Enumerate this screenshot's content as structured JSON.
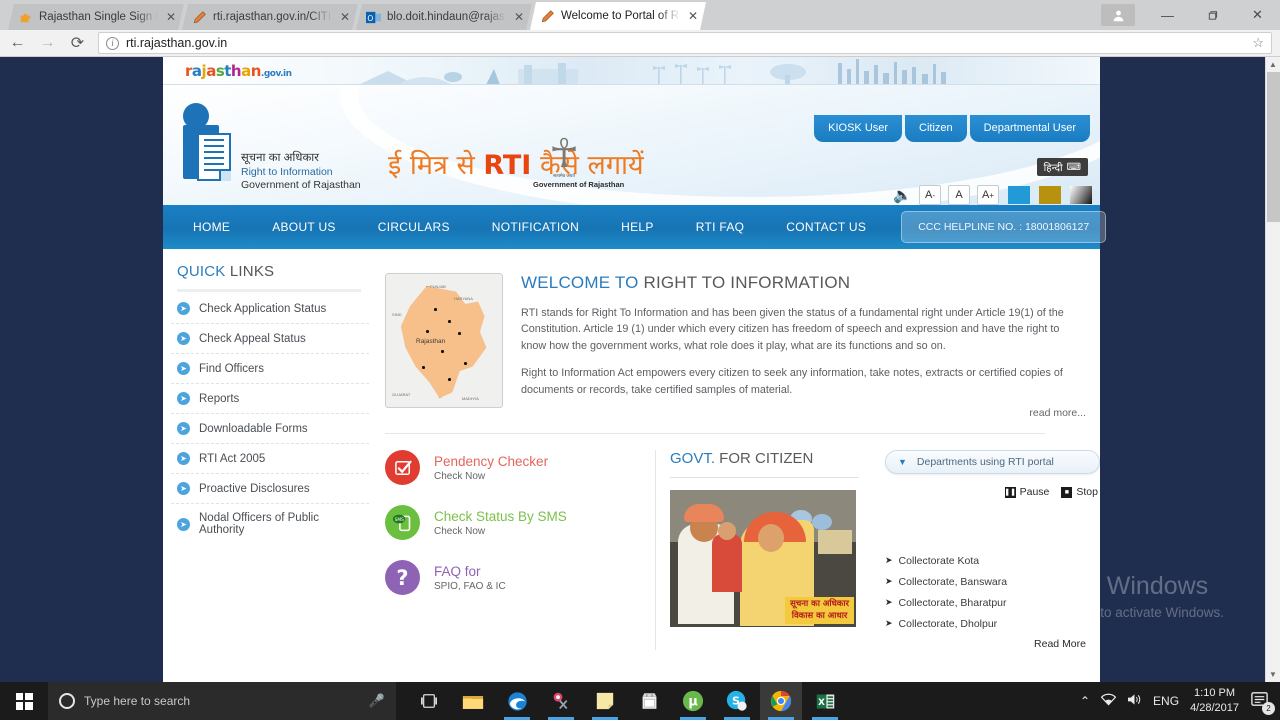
{
  "browser": {
    "tabs": [
      {
        "title": "Rajasthan Single Sign On",
        "favicon": "puzzle-icon",
        "active": false
      },
      {
        "title": "rti.rajasthan.gov.in/CITIZ",
        "favicon": "pencil-icon",
        "active": false
      },
      {
        "title": "blo.doit.hindaun@rajasth",
        "favicon": "outlook-icon",
        "active": false
      },
      {
        "title": "Welcome to Portal of Rig",
        "favicon": "pencil-icon",
        "active": true
      }
    ],
    "close_label": "✕",
    "window_controls": {
      "minimize": "—",
      "maximize": "❐",
      "close": "✕"
    },
    "toolbar": {
      "back": "←",
      "forward": "→",
      "reload": "⟳",
      "star": "☆"
    },
    "address": {
      "url": "rti.rajasthan.gov.in",
      "security": "info-icon"
    }
  },
  "site": {
    "brand": {
      "logo_parts": [
        "r",
        "a",
        "j",
        "a",
        "s",
        "t",
        "h",
        "a",
        "n"
      ],
      "logo_suffix": ".gov.in"
    },
    "masthead": {
      "rti_hindi": "सूचना का अधिकार",
      "rti_en1": "Right to Information",
      "rti_en2": "Government of Rajasthan",
      "banner_pre": "ई मित्र से ",
      "banner_rti": "RTI",
      "banner_post": " कैसे लगायें",
      "emblem_hindi": "सत्यमेव जयते",
      "emblem_caption": "Government of Rajasthan",
      "user_tabs": [
        "KIOSK User",
        "Citizen",
        "Departmental User"
      ],
      "hindi_button": "हिन्दी",
      "speaker_icon": "speaker-icon",
      "font_smaller": "A",
      "font_smaller_sup": "-",
      "font_normal": "A",
      "font_larger": "A",
      "font_larger_sup": "+",
      "theme_swatches": [
        "#229ad6",
        "#b8920f",
        "#000000"
      ]
    },
    "nav": {
      "items": [
        "HOME",
        "ABOUT US",
        "CIRCULARS",
        "NOTIFICATION",
        "HELP",
        "RTI FAQ",
        "CONTACT US"
      ],
      "helpline": "CCC HELPLINE NO. : 18001806127"
    },
    "sidebar": {
      "title_accent": "QUICK",
      "title_rest": " LINKS",
      "items": [
        "Check Application Status",
        "Check Appeal Status",
        "Find Officers",
        "Reports",
        "Downloadable Forms",
        "RTI Act 2005",
        "Proactive Disclosures",
        "Nodal Officers of Public Authority"
      ]
    },
    "welcome": {
      "title_accent": "WELCOME TO",
      "title_rest": " RIGHT TO INFORMATION",
      "map_label": "Rajasthan",
      "paragraph1": "RTI stands for Right To Information and has been given the status of a fundamental right under Article 19(1) of the Constitution. Article 19 (1) under which every citizen has freedom of speech and expression and have the right to know how the government works, what role does it play, what are its functions and so on.",
      "paragraph2": "Right to Information Act empowers every citizen to seek any information, take notes, extracts or certified copies of documents or records, take certified samples of material.",
      "read_more": "read more..."
    },
    "services": [
      {
        "title": "Pendency Checker",
        "subtitle": "Check Now",
        "icon": "checkbox-tick-icon",
        "color": "red"
      },
      {
        "title": "Check Status By SMS",
        "subtitle": "Check Now",
        "icon": "sms-phone-icon",
        "color": "green"
      },
      {
        "title": "FAQ for",
        "subtitle": "SPIO, FAO & IC",
        "icon": "question-mark-icon",
        "color": "purple"
      }
    ],
    "citizen": {
      "title_accent": "GOVT.",
      "title_rest": " FOR CITIZEN",
      "poster_caption_line1": "सूचना का अधिकार",
      "poster_caption_line2": "विकास का आधार"
    },
    "departments": {
      "header": "Departments using RTI portal",
      "pause": "Pause",
      "stop": "Stop",
      "items": [
        "Collectorate Kota",
        "Collectorate, Banswara",
        "Collectorate, Bharatpur",
        "Collectorate, Dholpur"
      ],
      "read_more": "Read More"
    }
  },
  "watermark": {
    "line1": "Activate Windows",
    "line2": "Go to Settings to activate Windows."
  },
  "taskbar": {
    "search_placeholder": "Type here to search",
    "icons": [
      {
        "name": "task-view-icon",
        "glyph": "❐"
      },
      {
        "name": "file-explorer-icon",
        "glyph": "📁"
      },
      {
        "name": "edge-browser-icon",
        "glyph": "e"
      },
      {
        "name": "snipping-tool-icon",
        "glyph": "✂"
      },
      {
        "name": "sticky-notes-icon",
        "glyph": "■"
      },
      {
        "name": "microsoft-store-icon",
        "glyph": "🛍"
      },
      {
        "name": "utorrent-icon",
        "glyph": "μ"
      },
      {
        "name": "skype-icon",
        "glyph": "S"
      },
      {
        "name": "google-chrome-icon",
        "glyph": "◉"
      },
      {
        "name": "excel-icon",
        "glyph": "X"
      }
    ],
    "tray": {
      "chevron": "⌃",
      "network": "network-icon",
      "volume": "🔊",
      "language": "ENG"
    },
    "clock": {
      "time": "1:10 PM",
      "date": "4/28/2017"
    },
    "notification_count": "2"
  }
}
